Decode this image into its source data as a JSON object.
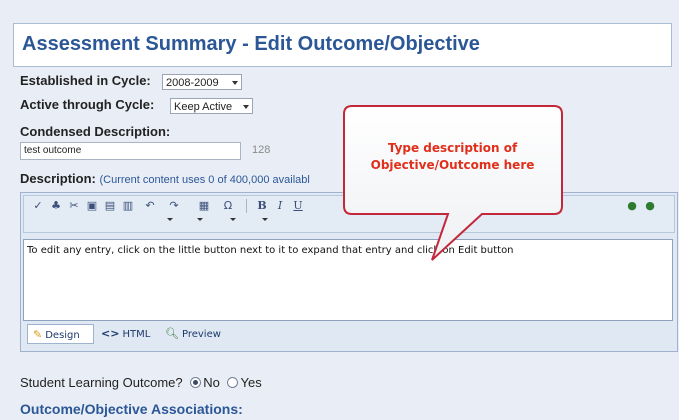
{
  "header": {
    "title": "Assessment Summary - Edit Outcome/Objective"
  },
  "fields": {
    "established_label": "Established in Cycle:",
    "established_value": "2008-2009",
    "active_label": "Active through Cycle:",
    "active_value": "Keep Active",
    "condensed_label": "Condensed Description:",
    "condensed_value": "test outcome",
    "condensed_count": "128",
    "description_label": "Description:",
    "description_note": "(Current content uses 0 of 400,000 availabl"
  },
  "editor": {
    "toolbar_icons": [
      "spellcheck-icon",
      "find-icon",
      "cut-icon",
      "copy-icon",
      "paste-icon",
      "paste-word-icon",
      "undo-icon",
      "redo-icon",
      "table-icon",
      "omega-icon",
      "bold-icon",
      "italic-icon",
      "underline-icon",
      "link-icon",
      "unlink-icon"
    ],
    "bold_label": "B",
    "italic_label": "I",
    "underline_label": "U",
    "omega_label": "Ω",
    "content_text": "To edit any entry, click on the little button  next to it to expand that entry and click on Edit button",
    "modes": {
      "design": "Design",
      "html": "HTML",
      "preview": "Preview"
    }
  },
  "callout": {
    "line1": "Type description of",
    "line2": "Objective/Outcome here",
    "color": "#e02f1a"
  },
  "slo": {
    "label": "Student Learning Outcome?",
    "no": "No",
    "yes": "Yes",
    "selected": "No"
  },
  "section": {
    "associations_title": "Outcome/Objective Associations:"
  },
  "colors": {
    "title": "#2b5797",
    "background": "#e9eef6",
    "border": "#a9bcd6"
  }
}
